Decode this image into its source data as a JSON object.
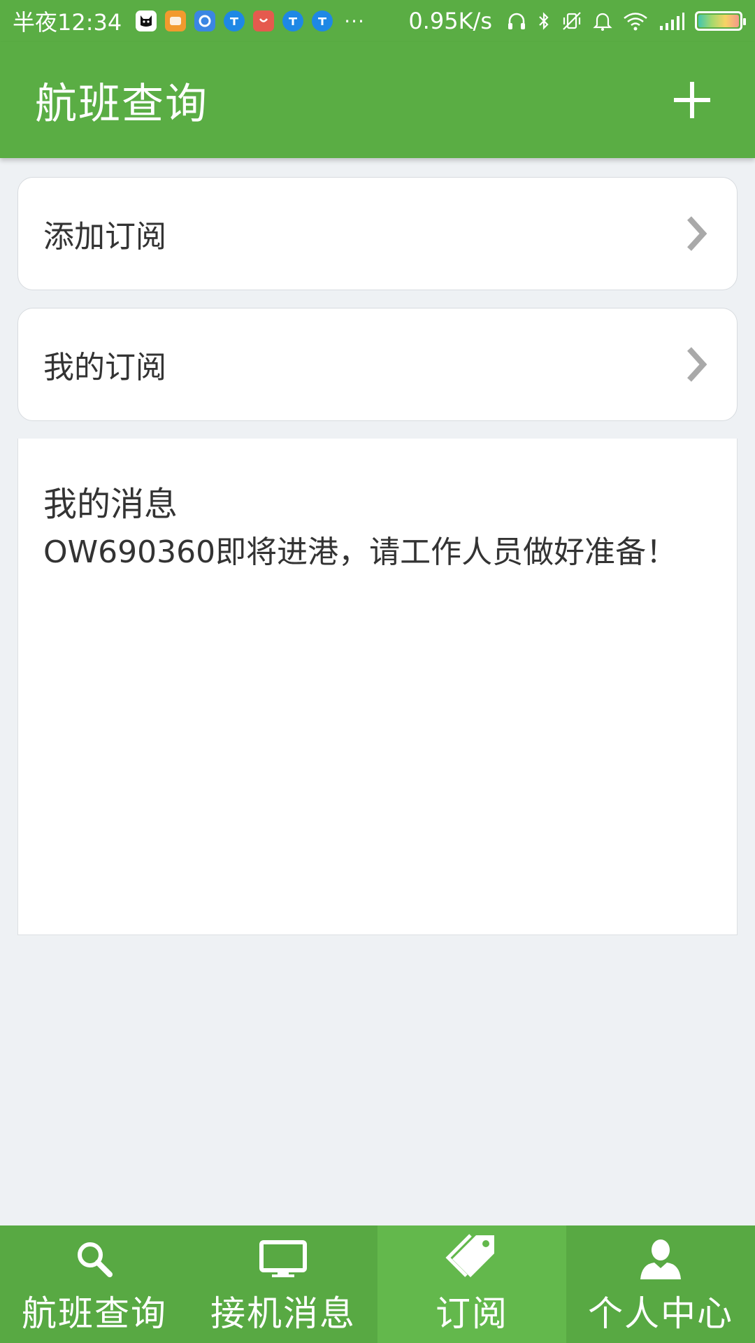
{
  "status_bar": {
    "time": "半夜12:34",
    "notification_icons": [
      "cat-app-icon",
      "orange-app-icon",
      "blue-app-icon",
      "zhihu-icon",
      "red-app-icon",
      "zhihu-icon",
      "zhihu-icon"
    ],
    "more": "···",
    "network_speed": "0.95K/s",
    "icons": [
      "headphone-icon",
      "bluetooth-icon",
      "vibrate-off-icon",
      "bell-icon",
      "wifi-icon",
      "signal-icon",
      "battery-icon"
    ]
  },
  "app_bar": {
    "title": "航班查询",
    "action_icon": "plus-icon"
  },
  "rows": {
    "add_subscription": "添加订阅",
    "my_subscription": "我的订阅"
  },
  "messages": {
    "title": "我的消息",
    "items": [
      "OW690360即将进港，请工作人员做好准备！"
    ]
  },
  "bottom_nav": {
    "tabs": [
      {
        "label": "航班查询",
        "icon": "search-icon",
        "active": false
      },
      {
        "label": "接机消息",
        "icon": "monitor-icon",
        "active": false
      },
      {
        "label": "订阅",
        "icon": "tag-icon",
        "active": true
      },
      {
        "label": "个人中心",
        "icon": "person-icon",
        "active": false
      }
    ]
  },
  "colors": {
    "primary_green": "#5aad44",
    "active_tab_green": "#63b84c",
    "background": "#eef1f4",
    "text_dark": "#333333"
  }
}
